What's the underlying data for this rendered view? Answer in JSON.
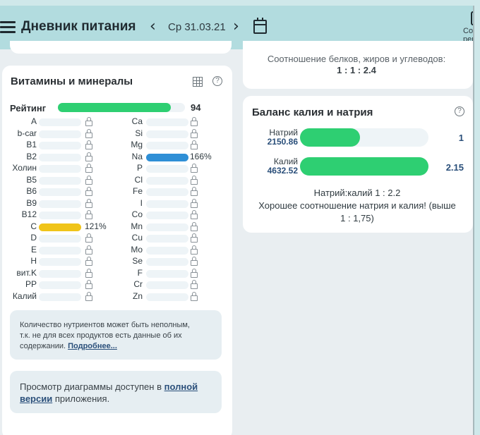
{
  "header": {
    "title": "Дневник питания",
    "date": "Ср 31.03.21",
    "create_label_1": "Созд",
    "create_label_2": "рец"
  },
  "vitamins": {
    "title": "Витамины и минералы",
    "rating_label": "Рейтинг",
    "rating_value": "94",
    "rating_fraction": 0.94,
    "left": [
      {
        "name": "A",
        "pct": ""
      },
      {
        "name": "b-car",
        "pct": ""
      },
      {
        "name": "B1",
        "pct": ""
      },
      {
        "name": "B2",
        "pct": ""
      },
      {
        "name": "Холин",
        "pct": ""
      },
      {
        "name": "B5",
        "pct": ""
      },
      {
        "name": "B6",
        "pct": ""
      },
      {
        "name": "B9",
        "pct": ""
      },
      {
        "name": "B12",
        "pct": ""
      },
      {
        "name": "C",
        "pct": "121%",
        "color": "#f0c419"
      },
      {
        "name": "D",
        "pct": ""
      },
      {
        "name": "E",
        "pct": ""
      },
      {
        "name": "H",
        "pct": ""
      },
      {
        "name": "вит.K",
        "pct": ""
      },
      {
        "name": "PP",
        "pct": ""
      },
      {
        "name": "Калий",
        "pct": ""
      }
    ],
    "right": [
      {
        "name": "Ca",
        "pct": ""
      },
      {
        "name": "Si",
        "pct": ""
      },
      {
        "name": "Mg",
        "pct": ""
      },
      {
        "name": "Na",
        "pct": "166%",
        "color": "#2f8fd6"
      },
      {
        "name": "P",
        "pct": ""
      },
      {
        "name": "Cl",
        "pct": ""
      },
      {
        "name": "Fe",
        "pct": ""
      },
      {
        "name": "I",
        "pct": ""
      },
      {
        "name": "Co",
        "pct": ""
      },
      {
        "name": "Mn",
        "pct": ""
      },
      {
        "name": "Cu",
        "pct": ""
      },
      {
        "name": "Mo",
        "pct": ""
      },
      {
        "name": "Se",
        "pct": ""
      },
      {
        "name": "F",
        "pct": ""
      },
      {
        "name": "Cr",
        "pct": ""
      },
      {
        "name": "Zn",
        "pct": ""
      }
    ],
    "note_line1": "Количество нутриентов может быть неполным,",
    "note_line2": "т.к. не для всех продуктов есть данные об их",
    "note_line3": "содержании.",
    "note_link": "Подробнее...",
    "diag_text1": "Просмотр диаграммы доступен в",
    "diag_link1": "полной",
    "diag_link2": "версии",
    "diag_text2": "приложения."
  },
  "macros": {
    "ratio_label": "Соотношение белков, жиров и углеводов:",
    "ratio_value": "1 : 1 : 2.4"
  },
  "balance": {
    "title": "Баланс калия и натрия",
    "sodium_label": "Натрий",
    "sodium_value": "2150.86",
    "sodium_ratio": "1",
    "sodium_fraction": 0.465,
    "potassium_label": "Калий",
    "potassium_value": "4632.52",
    "potassium_ratio": "2.15",
    "potassium_fraction": 1.0,
    "summary_ratio": "Натрий:калий 1 : 2.2",
    "summary_text1": "Хорошее соотношение натрия и калия! (выше",
    "summary_text2": "1 : 1,75)"
  },
  "colors": {
    "accent_green": "#2ecf72",
    "header_bg": "#b2dcdf",
    "link": "#2a4f7a"
  }
}
